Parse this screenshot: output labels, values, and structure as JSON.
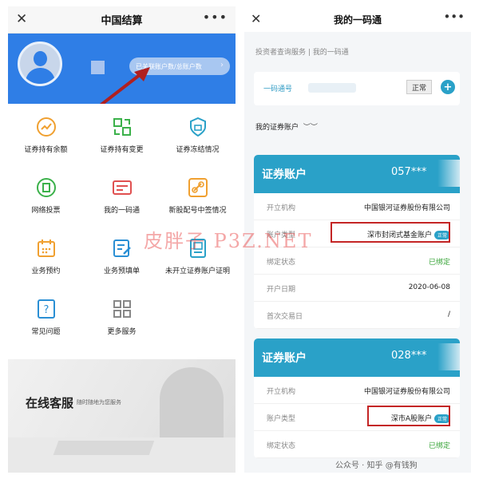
{
  "left": {
    "title": "中国结算",
    "close": "✕",
    "more": "•••",
    "linked_accounts": "已关联账户数/总账户数",
    "linked_chevron": "›",
    "menu": [
      {
        "label": "证券持有余额",
        "icon": "chart-line-icon"
      },
      {
        "label": "证券持有变更",
        "icon": "exchange-icon"
      },
      {
        "label": "证券冻结情况",
        "icon": "shield-icon"
      },
      {
        "label": "网络投票",
        "icon": "vote-icon"
      },
      {
        "label": "我的一码通",
        "icon": "card-icon"
      },
      {
        "label": "新股配号中签情况",
        "icon": "link-icon"
      },
      {
        "label": "业务预约",
        "icon": "calendar-icon"
      },
      {
        "label": "业务预填单",
        "icon": "form-edit-icon"
      },
      {
        "label": "未开立证券账户证明",
        "icon": "document-icon"
      },
      {
        "label": "常见问题",
        "icon": "question-icon"
      },
      {
        "label": "更多服务",
        "icon": "grid-icon"
      }
    ],
    "service_title": "在线客服",
    "service_subtitle": "随时随地为您服务"
  },
  "watermark": "皮胖子 P3Z.NET",
  "right": {
    "title": "我的一码通",
    "close": "✕",
    "more": "•••",
    "breadcrumb": "投资者查询服务 | 我的一码通",
    "yima_label": "一码通号",
    "yima_status": "正常",
    "my_accounts": "我的证券账户",
    "accounts": [
      {
        "header": "证券账户",
        "number": "057***",
        "rows": [
          {
            "key": "开立机构",
            "value": "中国银河证券股份有限公司"
          },
          {
            "key": "账户类型",
            "value": "深市封闭式基金账户",
            "badge": "正常"
          },
          {
            "key": "绑定状态",
            "value": "已绑定"
          },
          {
            "key": "开户日期",
            "value": "2020-06-08"
          },
          {
            "key": "首次交易日",
            "value": "/"
          }
        ]
      },
      {
        "header": "证券账户",
        "number": "028***",
        "rows": [
          {
            "key": "开立机构",
            "value": "中国银河证券股份有限公司"
          },
          {
            "key": "账户类型",
            "value": "深市A股账户",
            "badge": "正常"
          },
          {
            "key": "绑定状态",
            "value": "已绑定"
          }
        ]
      }
    ],
    "footer_mark": "公众号 · 知乎 @有钱狗"
  },
  "colors": {
    "brand_blue": "#2f7ee6",
    "teal": "#2aa1c8",
    "highlight_red": "#c42525",
    "bound_green": "#3aa53a"
  }
}
